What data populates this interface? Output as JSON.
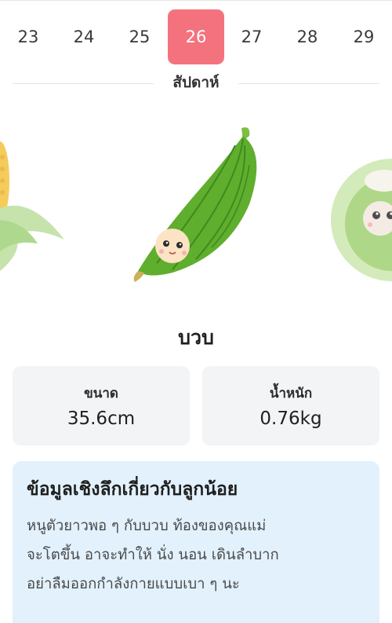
{
  "week_selector": {
    "weeks": [
      "23",
      "24",
      "25",
      "26",
      "27",
      "28",
      "29"
    ],
    "selected_week": "26",
    "label": "สัปดาห์"
  },
  "baby": {
    "fruit_name": "บวบ",
    "size_label": "ขนาด",
    "size_value": "35.6cm",
    "weight_label": "น้ำหนัก",
    "weight_value": "0.76kg"
  },
  "insight": {
    "title": "ข้อมูลเชิงลึกเกี่ยวกับลูกน้อย",
    "lines": [
      "หนูตัวยาวพอ ๆ กับบวบ ท้องของคุณแม่",
      "จะโตขึ้น อาจะทำให้ นั่ง นอน เดินลำบาก",
      "อย่าลืมออกกำลังกายแบบเบา ๆ นะ"
    ]
  },
  "colors": {
    "selected_week_bg": "#f4727e",
    "insight_bg": "#e2f1fc",
    "stat_card_bg": "#f3f4f6"
  },
  "icons": {
    "previous_fruit": "corn-icon",
    "current_fruit": "loofah-icon",
    "next_fruit": "coconut-icon"
  }
}
